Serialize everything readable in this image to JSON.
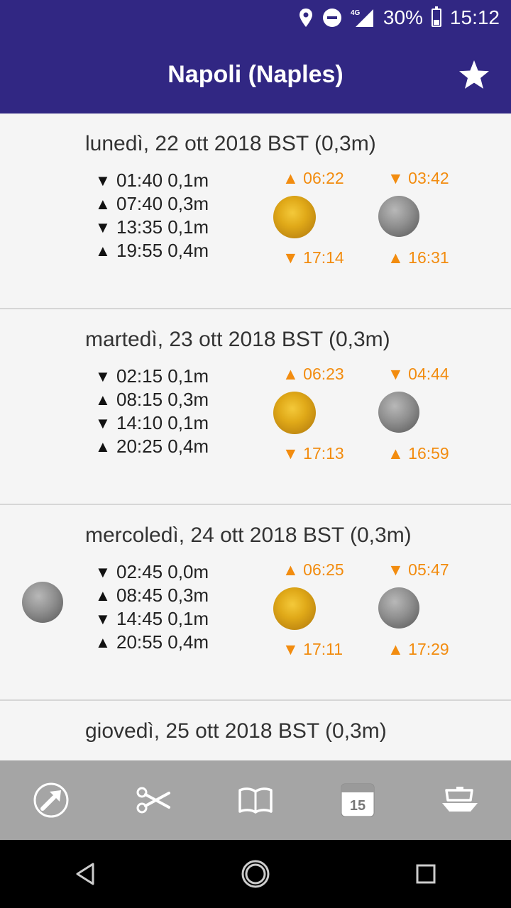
{
  "status_bar": {
    "network": "4G",
    "battery_percent": "30%",
    "battery_level": 0.3,
    "time": "15:12",
    "icons": [
      "location-icon",
      "do-not-disturb-icon",
      "signal-icon",
      "battery-icon"
    ]
  },
  "app_bar": {
    "title": "Napoli (Naples)",
    "favorite_icon": "star-icon"
  },
  "days": [
    {
      "title": "lunedì, 22 ott 2018 BST (0,3m)",
      "tides": [
        {
          "arrow": "▼",
          "text": "01:40 0,1m"
        },
        {
          "arrow": "▲",
          "text": "07:40 0,3m"
        },
        {
          "arrow": "▼",
          "text": "13:35 0,1m"
        },
        {
          "arrow": "▲",
          "text": "19:55 0,4m"
        }
      ],
      "sunrise": "▲ 06:22",
      "sunset": "▼ 17:14",
      "moonset": "▼ 03:42",
      "moonrise": "▲ 16:31",
      "moon_phase_shown": false
    },
    {
      "title": "martedì, 23 ott 2018 BST (0,3m)",
      "tides": [
        {
          "arrow": "▼",
          "text": "02:15 0,1m"
        },
        {
          "arrow": "▲",
          "text": "08:15 0,3m"
        },
        {
          "arrow": "▼",
          "text": "14:10 0,1m"
        },
        {
          "arrow": "▲",
          "text": "20:25 0,4m"
        }
      ],
      "sunrise": "▲ 06:23",
      "sunset": "▼ 17:13",
      "moonset": "▼ 04:44",
      "moonrise": "▲ 16:59",
      "moon_phase_shown": false
    },
    {
      "title": "mercoledì, 24 ott 2018 BST (0,3m)",
      "tides": [
        {
          "arrow": "▼",
          "text": "02:45 0,0m"
        },
        {
          "arrow": "▲",
          "text": "08:45 0,3m"
        },
        {
          "arrow": "▼",
          "text": "14:45 0,1m"
        },
        {
          "arrow": "▲",
          "text": "20:55 0,4m"
        }
      ],
      "sunrise": "▲ 06:25",
      "sunset": "▼ 17:11",
      "moonset": "▼ 05:47",
      "moonrise": "▲ 17:29",
      "moon_phase_shown": true
    },
    {
      "title": "giovedì, 25 ott 2018 BST (0,3m)"
    }
  ],
  "toolbar": {
    "items": [
      "compass-icon",
      "scissors-icon",
      "book-icon",
      "calendar-icon",
      "boat-icon"
    ],
    "calendar_day": "15"
  },
  "nav_bar": {
    "items": [
      "back-icon",
      "home-icon",
      "recents-icon"
    ]
  },
  "colors": {
    "primary": "#312783",
    "accent": "#f28c0f",
    "toolbar": "#a5a5a5"
  }
}
